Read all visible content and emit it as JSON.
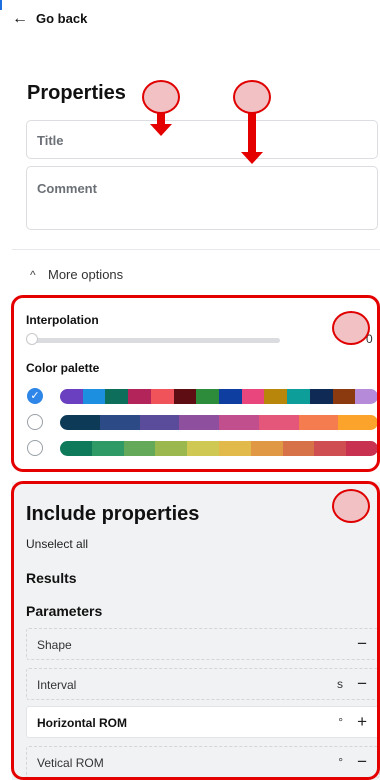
{
  "header": {
    "back_label": "Go back",
    "back_icon": "arrow-left-icon"
  },
  "properties": {
    "title": "Properties",
    "title_placeholder": "Title",
    "comment_placeholder": "Comment"
  },
  "more_options": {
    "label": "More options",
    "icon": "chevron-up-icon"
  },
  "interpolation": {
    "label": "Interpolation",
    "value": "0",
    "level": 0
  },
  "color_palette": {
    "label": "Color palette",
    "selected_index": 0,
    "palettes": [
      [
        "#6a3fc0",
        "#1d8fe0",
        "#0e6e5c",
        "#b2245a",
        "#f0535a",
        "#5e0e12",
        "#2d8c3c",
        "#0e3fa0",
        "#e8467c",
        "#b8860b",
        "#0e9e9a",
        "#0e2a55",
        "#8a3a0e",
        "#b58ad8"
      ],
      [
        "#0d3b57",
        "#2c4a86",
        "#5a4b9b",
        "#8e4f9e",
        "#c24f8d",
        "#e5577a",
        "#f47c4f",
        "#fba32b"
      ],
      [
        "#0e7a5a",
        "#2f9a65",
        "#64a85a",
        "#9bb84f",
        "#cfc852",
        "#e2b94b",
        "#e19845",
        "#d77148",
        "#cf4e52",
        "#c8314f"
      ]
    ]
  },
  "include": {
    "title": "Include properties",
    "unselect_all": "Unselect all",
    "results_label": "Results",
    "parameters_label": "Parameters",
    "rows": [
      {
        "name": "Shape",
        "unit": "",
        "action": "−",
        "active": false
      },
      {
        "name": "Interval",
        "unit": "s",
        "action": "−",
        "active": false
      },
      {
        "name": "Horizontal ROM",
        "unit": "°",
        "action": "+",
        "active": true
      },
      {
        "name": "Vetical ROM",
        "unit": "°",
        "action": "−",
        "active": false
      }
    ]
  },
  "annotation_color": "#e50000"
}
